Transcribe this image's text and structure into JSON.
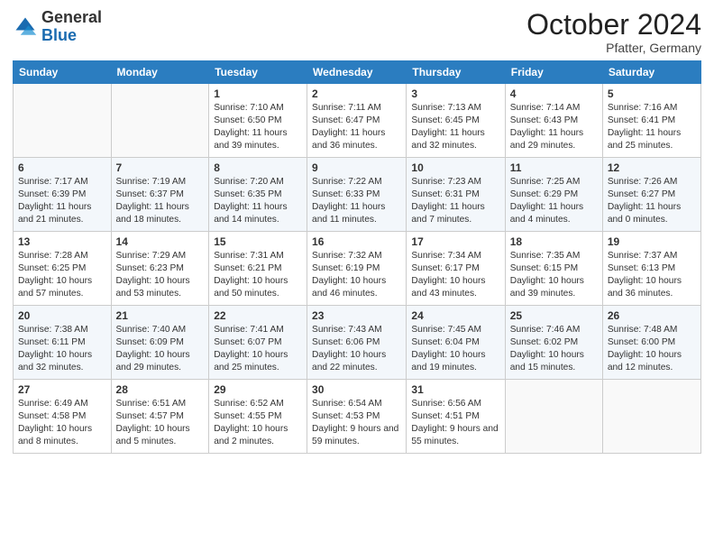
{
  "logo": {
    "general": "General",
    "blue": "Blue"
  },
  "title": "October 2024",
  "subtitle": "Pfatter, Germany",
  "days": [
    "Sunday",
    "Monday",
    "Tuesday",
    "Wednesday",
    "Thursday",
    "Friday",
    "Saturday"
  ],
  "weeks": [
    [
      {
        "day": "",
        "content": ""
      },
      {
        "day": "",
        "content": ""
      },
      {
        "day": "1",
        "content": "Sunrise: 7:10 AM\nSunset: 6:50 PM\nDaylight: 11 hours and 39 minutes."
      },
      {
        "day": "2",
        "content": "Sunrise: 7:11 AM\nSunset: 6:47 PM\nDaylight: 11 hours and 36 minutes."
      },
      {
        "day": "3",
        "content": "Sunrise: 7:13 AM\nSunset: 6:45 PM\nDaylight: 11 hours and 32 minutes."
      },
      {
        "day": "4",
        "content": "Sunrise: 7:14 AM\nSunset: 6:43 PM\nDaylight: 11 hours and 29 minutes."
      },
      {
        "day": "5",
        "content": "Sunrise: 7:16 AM\nSunset: 6:41 PM\nDaylight: 11 hours and 25 minutes."
      }
    ],
    [
      {
        "day": "6",
        "content": "Sunrise: 7:17 AM\nSunset: 6:39 PM\nDaylight: 11 hours and 21 minutes."
      },
      {
        "day": "7",
        "content": "Sunrise: 7:19 AM\nSunset: 6:37 PM\nDaylight: 11 hours and 18 minutes."
      },
      {
        "day": "8",
        "content": "Sunrise: 7:20 AM\nSunset: 6:35 PM\nDaylight: 11 hours and 14 minutes."
      },
      {
        "day": "9",
        "content": "Sunrise: 7:22 AM\nSunset: 6:33 PM\nDaylight: 11 hours and 11 minutes."
      },
      {
        "day": "10",
        "content": "Sunrise: 7:23 AM\nSunset: 6:31 PM\nDaylight: 11 hours and 7 minutes."
      },
      {
        "day": "11",
        "content": "Sunrise: 7:25 AM\nSunset: 6:29 PM\nDaylight: 11 hours and 4 minutes."
      },
      {
        "day": "12",
        "content": "Sunrise: 7:26 AM\nSunset: 6:27 PM\nDaylight: 11 hours and 0 minutes."
      }
    ],
    [
      {
        "day": "13",
        "content": "Sunrise: 7:28 AM\nSunset: 6:25 PM\nDaylight: 10 hours and 57 minutes."
      },
      {
        "day": "14",
        "content": "Sunrise: 7:29 AM\nSunset: 6:23 PM\nDaylight: 10 hours and 53 minutes."
      },
      {
        "day": "15",
        "content": "Sunrise: 7:31 AM\nSunset: 6:21 PM\nDaylight: 10 hours and 50 minutes."
      },
      {
        "day": "16",
        "content": "Sunrise: 7:32 AM\nSunset: 6:19 PM\nDaylight: 10 hours and 46 minutes."
      },
      {
        "day": "17",
        "content": "Sunrise: 7:34 AM\nSunset: 6:17 PM\nDaylight: 10 hours and 43 minutes."
      },
      {
        "day": "18",
        "content": "Sunrise: 7:35 AM\nSunset: 6:15 PM\nDaylight: 10 hours and 39 minutes."
      },
      {
        "day": "19",
        "content": "Sunrise: 7:37 AM\nSunset: 6:13 PM\nDaylight: 10 hours and 36 minutes."
      }
    ],
    [
      {
        "day": "20",
        "content": "Sunrise: 7:38 AM\nSunset: 6:11 PM\nDaylight: 10 hours and 32 minutes."
      },
      {
        "day": "21",
        "content": "Sunrise: 7:40 AM\nSunset: 6:09 PM\nDaylight: 10 hours and 29 minutes."
      },
      {
        "day": "22",
        "content": "Sunrise: 7:41 AM\nSunset: 6:07 PM\nDaylight: 10 hours and 25 minutes."
      },
      {
        "day": "23",
        "content": "Sunrise: 7:43 AM\nSunset: 6:06 PM\nDaylight: 10 hours and 22 minutes."
      },
      {
        "day": "24",
        "content": "Sunrise: 7:45 AM\nSunset: 6:04 PM\nDaylight: 10 hours and 19 minutes."
      },
      {
        "day": "25",
        "content": "Sunrise: 7:46 AM\nSunset: 6:02 PM\nDaylight: 10 hours and 15 minutes."
      },
      {
        "day": "26",
        "content": "Sunrise: 7:48 AM\nSunset: 6:00 PM\nDaylight: 10 hours and 12 minutes."
      }
    ],
    [
      {
        "day": "27",
        "content": "Sunrise: 6:49 AM\nSunset: 4:58 PM\nDaylight: 10 hours and 8 minutes."
      },
      {
        "day": "28",
        "content": "Sunrise: 6:51 AM\nSunset: 4:57 PM\nDaylight: 10 hours and 5 minutes."
      },
      {
        "day": "29",
        "content": "Sunrise: 6:52 AM\nSunset: 4:55 PM\nDaylight: 10 hours and 2 minutes."
      },
      {
        "day": "30",
        "content": "Sunrise: 6:54 AM\nSunset: 4:53 PM\nDaylight: 9 hours and 59 minutes."
      },
      {
        "day": "31",
        "content": "Sunrise: 6:56 AM\nSunset: 4:51 PM\nDaylight: 9 hours and 55 minutes."
      },
      {
        "day": "",
        "content": ""
      },
      {
        "day": "",
        "content": ""
      }
    ]
  ]
}
